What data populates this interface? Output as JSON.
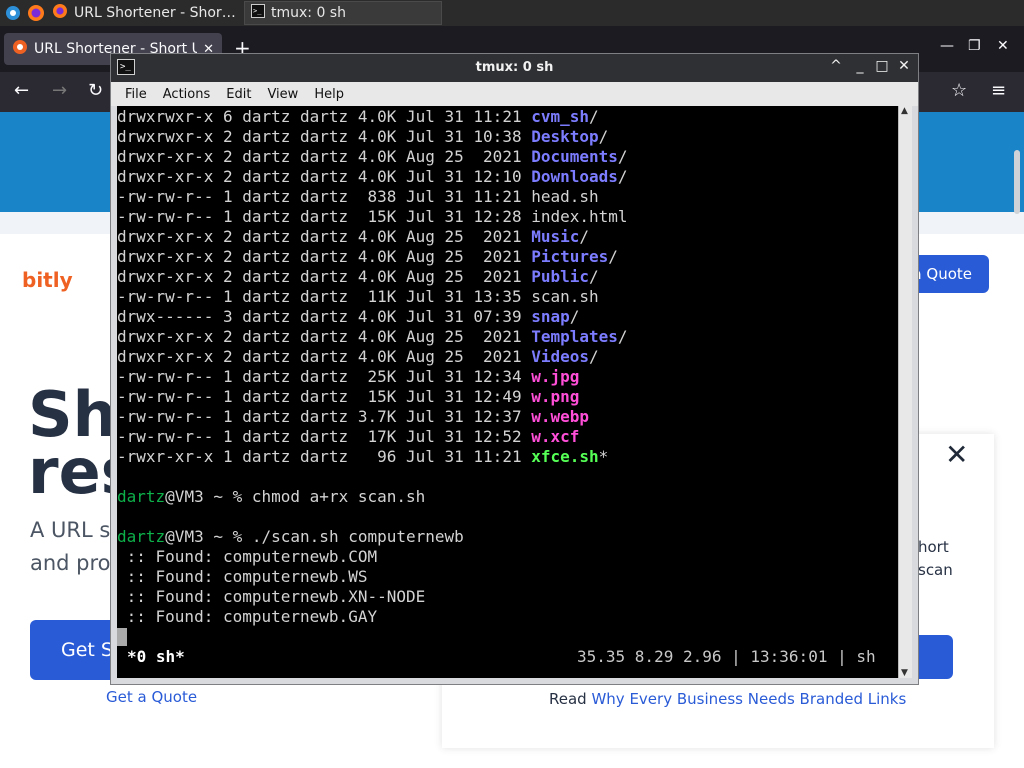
{
  "taskbar": {
    "tasks": [
      {
        "label": "URL Shortener - Short U..."
      },
      {
        "label": "tmux: 0 sh"
      }
    ]
  },
  "browser": {
    "tab_label": "URL Shortener - Short UR",
    "new_tab": "+"
  },
  "page": {
    "logo": "bitly",
    "quote_button": "a Quote",
    "hero_line1": "Sho",
    "hero_line2": "res",
    "sub_line1": "A URL s",
    "sub_line2": "and pro",
    "get_started": "Get S",
    "get_quote": "Get a Quote",
    "card_text1": "hort",
    "card_text2": "scan",
    "card_read_prefix": "Read ",
    "card_read_link": "Why Every Business Needs Branded Links"
  },
  "terminal": {
    "title": "tmux: 0 sh",
    "menu": [
      "File",
      "Actions",
      "Edit",
      "View",
      "Help"
    ],
    "listing": [
      {
        "meta": "drwxrwxr-x 6 dartz dartz 4.0K Jul 31 11:21 ",
        "name": "cvm_sh",
        "suffix": "/",
        "kind": "dir"
      },
      {
        "meta": "drwxrwxr-x 2 dartz dartz 4.0K Jul 31 10:38 ",
        "name": "Desktop",
        "suffix": "/",
        "kind": "dir"
      },
      {
        "meta": "drwxr-xr-x 2 dartz dartz 4.0K Aug 25  2021 ",
        "name": "Documents",
        "suffix": "/",
        "kind": "dir"
      },
      {
        "meta": "drwxr-xr-x 2 dartz dartz 4.0K Jul 31 12:10 ",
        "name": "Downloads",
        "suffix": "/",
        "kind": "dir"
      },
      {
        "meta": "-rw-rw-r-- 1 dartz dartz  838 Jul 31 11:21 ",
        "name": "head.sh",
        "suffix": "",
        "kind": "file"
      },
      {
        "meta": "-rw-rw-r-- 1 dartz dartz  15K Jul 31 12:28 ",
        "name": "index.html",
        "suffix": "",
        "kind": "file"
      },
      {
        "meta": "drwxr-xr-x 2 dartz dartz 4.0K Aug 25  2021 ",
        "name": "Music",
        "suffix": "/",
        "kind": "dir"
      },
      {
        "meta": "drwxr-xr-x 2 dartz dartz 4.0K Aug 25  2021 ",
        "name": "Pictures",
        "suffix": "/",
        "kind": "dir"
      },
      {
        "meta": "drwxr-xr-x 2 dartz dartz 4.0K Aug 25  2021 ",
        "name": "Public",
        "suffix": "/",
        "kind": "dir"
      },
      {
        "meta": "-rw-rw-r-- 1 dartz dartz  11K Jul 31 13:35 ",
        "name": "scan.sh",
        "suffix": "",
        "kind": "file"
      },
      {
        "meta": "drwx------ 3 dartz dartz 4.0K Jul 31 07:39 ",
        "name": "snap",
        "suffix": "/",
        "kind": "dir"
      },
      {
        "meta": "drwxr-xr-x 2 dartz dartz 4.0K Aug 25  2021 ",
        "name": "Templates",
        "suffix": "/",
        "kind": "dir"
      },
      {
        "meta": "drwxr-xr-x 2 dartz dartz 4.0K Aug 25  2021 ",
        "name": "Videos",
        "suffix": "/",
        "kind": "dir"
      },
      {
        "meta": "-rw-rw-r-- 1 dartz dartz  25K Jul 31 12:34 ",
        "name": "w.jpg",
        "suffix": "",
        "kind": "img"
      },
      {
        "meta": "-rw-rw-r-- 1 dartz dartz  15K Jul 31 12:49 ",
        "name": "w.png",
        "suffix": "",
        "kind": "img"
      },
      {
        "meta": "-rw-rw-r-- 1 dartz dartz 3.7K Jul 31 12:37 ",
        "name": "w.webp",
        "suffix": "",
        "kind": "img"
      },
      {
        "meta": "-rw-rw-r-- 1 dartz dartz  17K Jul 31 12:52 ",
        "name": "w.xcf",
        "suffix": "",
        "kind": "img"
      },
      {
        "meta": "-rwxr-xr-x 1 dartz dartz   96 Jul 31 11:21 ",
        "name": "xfce.sh",
        "suffix": "*",
        "kind": "exe"
      }
    ],
    "prompt_user": "dartz",
    "prompt_rest": "@VM3 ~ % ",
    "cmd1": "chmod a+rx scan.sh",
    "cmd2": "./scan.sh computernewb",
    "found": [
      " :: Found: computernewb.COM",
      " :: Found: computernewb.WS",
      " :: Found: computernewb.XN--NODE",
      " :: Found: computernewb.GAY"
    ],
    "status_left": "*0 sh*",
    "status_right": "35.35 8.29 2.96 | 13:36:01 | sh"
  }
}
